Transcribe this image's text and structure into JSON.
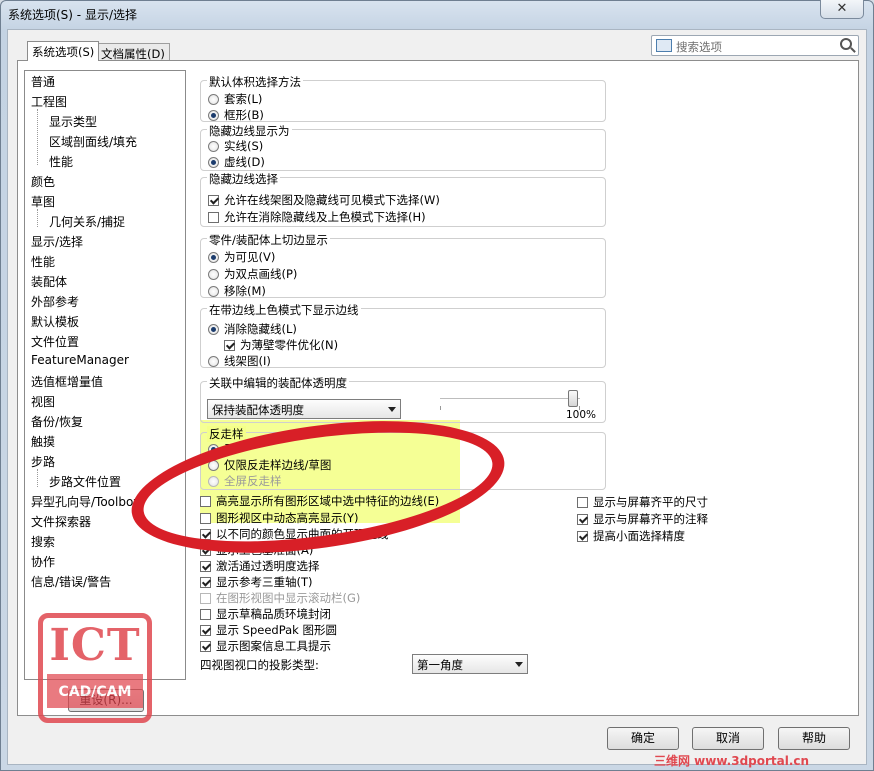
{
  "window": {
    "title": "系统选项(S) - 显示/选择",
    "close_glyph": "✕"
  },
  "tabs": [
    "系统选项(S)",
    "文档属性(D)"
  ],
  "search": {
    "placeholder": "搜索选项"
  },
  "tree": [
    "普通",
    "工程图",
    "显示类型",
    "区域剖面线/填充",
    "性能",
    "颜色",
    "草图",
    "几何关系/捕捉",
    "显示/选择",
    "性能",
    "装配体",
    "外部参考",
    "默认模板",
    "文件位置",
    "FeatureManager",
    "选值框增量值",
    "视图",
    "备份/恢复",
    "触摸",
    "步路",
    "步路文件位置",
    "异型孔向导/Toolbox",
    "文件探索器",
    "搜索",
    "协作",
    "信息/错误/警告"
  ],
  "groups": {
    "g1": {
      "label": "默认体积选择方法",
      "opts": [
        "套索(L)",
        "框形(B)"
      ]
    },
    "g2": {
      "label": "隐藏边线显示为",
      "opts": [
        "实线(S)",
        "虚线(D)"
      ]
    },
    "g3": {
      "label": "隐藏边线选择",
      "opts": [
        "允许在线架图及隐藏线可见模式下选择(W)",
        "允许在消除隐藏线及上色模式下选择(H)"
      ]
    },
    "g4": {
      "label": "零件/装配体上切边显示",
      "opts": [
        "为可见(V)",
        "为双点画线(P)",
        "移除(M)"
      ]
    },
    "g5": {
      "label": "在带边线上色模式下显示边线",
      "opts": [
        "消除隐藏线(L)",
        "为薄壁零件优化(N)",
        "线架图(I)"
      ]
    },
    "g6": {
      "label": "关联中编辑的装配体透明度",
      "combo": "保持装配体透明度",
      "slider_value": "100%",
      "slider_fraction": 0.95
    },
    "g7": {
      "label": "反走样",
      "opts": [
        "无",
        "仅限反走样边线/草图",
        "全屏反走样"
      ]
    }
  },
  "checks": [
    "高亮显示所有图形区域中选中特征的边线(E)",
    "图形视区中动态高亮显示(Y)",
    "以不同的颜色显示曲面的开环边线",
    "显示上色基准面(A)",
    "激活通过透明度选择",
    "显示参考三重轴(T)",
    "在图形视图中显示滚动栏(G)",
    "显示草稿品质环境封闭",
    "显示 SpeedPak 图形圆",
    "显示图案信息工具提示"
  ],
  "right_checks": [
    "显示与屏幕齐平的尺寸",
    "显示与屏幕齐平的注释",
    "提高小面选择精度"
  ],
  "projection": {
    "label": "四视图视口的投影类型:",
    "value": "第一角度"
  },
  "buttons": {
    "reset": "重设(R)...",
    "ok": "确定",
    "cancel": "取消",
    "help": "帮助"
  },
  "watermark": {
    "logo": "ICT",
    "sub": "CAD/CAM",
    "site": "三维网 www.3dportal.cn"
  },
  "colors": {
    "ring": "#d81f27",
    "highlight": "#f4ff8a"
  }
}
